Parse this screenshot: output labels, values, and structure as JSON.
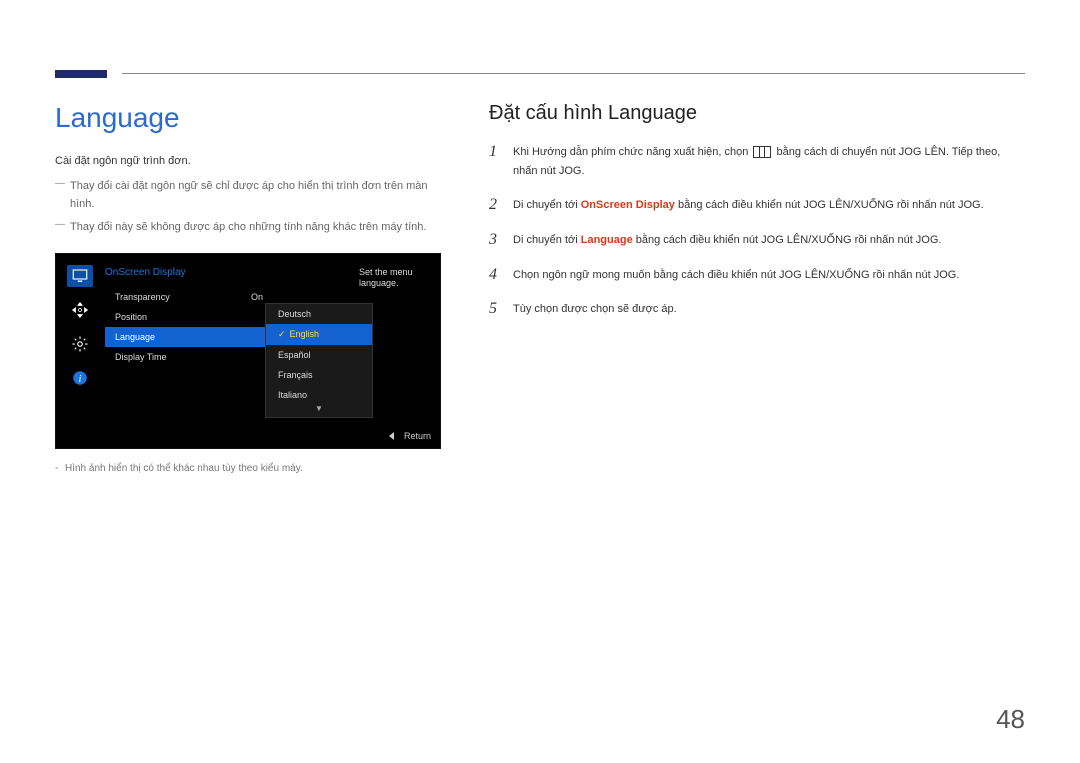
{
  "left": {
    "heading": "Language",
    "intro": "Cài đặt ngôn ngữ trình đơn.",
    "notes": [
      "Thay đổi cài đặt ngôn ngữ sẽ chỉ được áp cho hiển thị trình đơn trên màn hình.",
      "Thay đổi này sẽ không được áp cho những tính năng khác trên máy tính."
    ],
    "img_note": "Hình ảnh hiển thị có thể khác nhau tùy theo kiểu máy."
  },
  "osd": {
    "title": "OnScreen Display",
    "help": "Set the menu language.",
    "menu": [
      {
        "label": "Transparency",
        "value": "On"
      },
      {
        "label": "Position",
        "value": ""
      },
      {
        "label": "Language",
        "value": "",
        "selected": true
      },
      {
        "label": "Display Time",
        "value": ""
      }
    ],
    "options": [
      {
        "label": "Deutsch"
      },
      {
        "label": "English",
        "selected": true
      },
      {
        "label": "Español"
      },
      {
        "label": "Français"
      },
      {
        "label": "Italiano"
      }
    ],
    "return_label": "Return"
  },
  "right": {
    "heading": "Đặt cấu hình Language",
    "steps": [
      {
        "n": "1",
        "pre": "Khi Hướng dẫn phím chức năng xuất hiện, chọn ",
        "post": " bằng cách di chuyển nút JOG LÊN. Tiếp theo, nhấn nút JOG."
      },
      {
        "n": "2",
        "pre": "Di chuyển tới ",
        "hl": "OnScreen Display",
        "post": " bằng cách điều khiển nút JOG LÊN/XUỐNG rồi nhấn nút JOG."
      },
      {
        "n": "3",
        "pre": "Di chuyển tới ",
        "hl": "Language",
        "post": " bằng cách điều khiển nút JOG LÊN/XUỐNG rồi nhấn nút JOG."
      },
      {
        "n": "4",
        "text": "Chọn ngôn ngữ mong muốn bằng cách điều khiển nút JOG LÊN/XUỐNG rồi nhấn nút JOG."
      },
      {
        "n": "5",
        "text": "Tùy chọn được chọn sẽ được áp."
      }
    ]
  },
  "page_number": "48"
}
